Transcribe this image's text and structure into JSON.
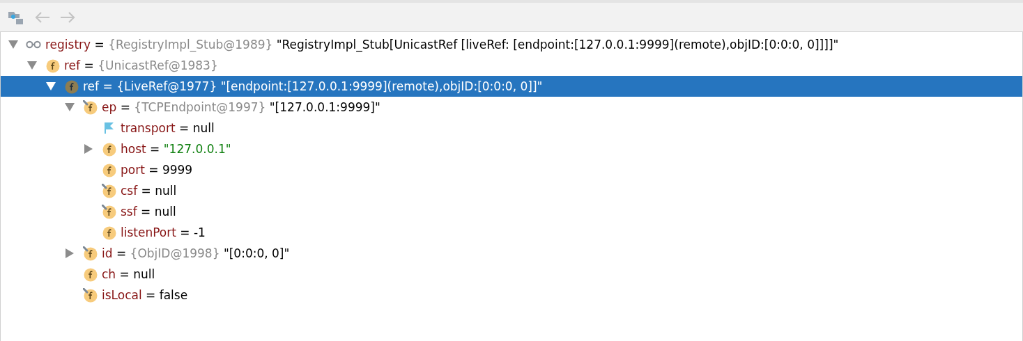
{
  "toolbar": {
    "back": {
      "disabled": true
    },
    "forward": {
      "disabled": true
    }
  },
  "tree": [
    {
      "kind": "watch",
      "name": "registry",
      "sign": "=",
      "type": "{RegistryImpl_Stub@1989}",
      "value": "\"RegistryImpl_Stub[UnicastRef [liveRef: [endpoint:[127.0.0.1:9999](remote),objID:[0:0:0, 0]]]]\"",
      "string": false,
      "expanded": true,
      "selected": false,
      "children": [
        {
          "kind": "field",
          "final": false,
          "name": "ref",
          "sign": "=",
          "type": "{UnicastRef@1983}",
          "expanded": true,
          "selected": false,
          "children": [
            {
              "kind": "field",
              "final": false,
              "name": "ref",
              "sign": "=",
              "type": "{LiveRef@1977}",
              "value": "\"[endpoint:[127.0.0.1:9999](remote),objID:[0:0:0, 0]]\"",
              "string": false,
              "expanded": true,
              "selected": true,
              "children": [
                {
                  "kind": "field",
                  "final": true,
                  "name": "ep",
                  "sign": "=",
                  "type": "{TCPEndpoint@1997}",
                  "value": "\"[127.0.0.1:9999]\"",
                  "string": false,
                  "expanded": true,
                  "selected": false,
                  "children": [
                    {
                      "kind": "flag",
                      "name": "transport",
                      "sign": "=",
                      "value": "null",
                      "string": false,
                      "selected": false
                    },
                    {
                      "kind": "field",
                      "final": false,
                      "name": "host",
                      "sign": "=",
                      "value": "\"127.0.0.1\"",
                      "string": true,
                      "expanded": false,
                      "selected": false
                    },
                    {
                      "kind": "field",
                      "final": false,
                      "name": "port",
                      "sign": "=",
                      "value": "9999",
                      "string": false,
                      "selected": false
                    },
                    {
                      "kind": "field",
                      "final": true,
                      "name": "csf",
                      "sign": "=",
                      "value": "null",
                      "string": false,
                      "selected": false
                    },
                    {
                      "kind": "field",
                      "final": true,
                      "name": "ssf",
                      "sign": "=",
                      "value": "null",
                      "string": false,
                      "selected": false
                    },
                    {
                      "kind": "field",
                      "final": false,
                      "name": "listenPort",
                      "sign": "=",
                      "value": "-1",
                      "string": false,
                      "selected": false
                    }
                  ]
                },
                {
                  "kind": "field",
                  "final": true,
                  "name": "id",
                  "sign": "=",
                  "type": "{ObjID@1998}",
                  "value": "\"[0:0:0, 0]\"",
                  "string": false,
                  "expanded": false,
                  "selected": false
                },
                {
                  "kind": "field",
                  "final": false,
                  "name": "ch",
                  "sign": "=",
                  "value": "null",
                  "string": false,
                  "selected": false
                },
                {
                  "kind": "field",
                  "final": true,
                  "name": "isLocal",
                  "sign": "=",
                  "value": "false",
                  "string": false,
                  "selected": false
                }
              ]
            }
          ]
        }
      ]
    }
  ]
}
